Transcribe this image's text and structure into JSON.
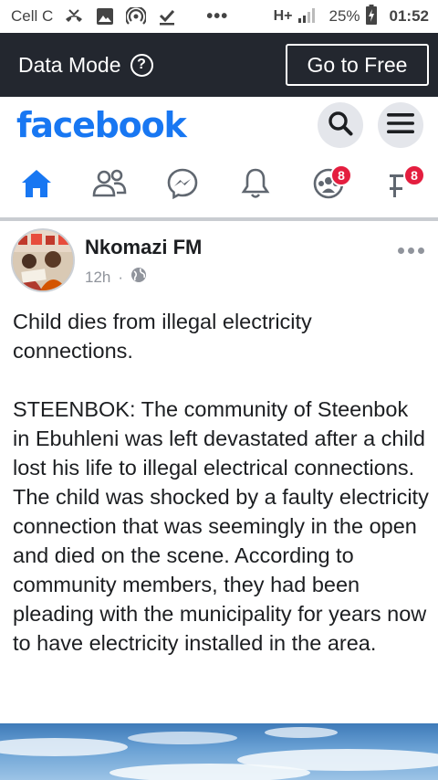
{
  "status_bar": {
    "carrier": "Cell C",
    "network": "H+",
    "battery": "25%",
    "time": "01:52"
  },
  "data_mode": {
    "label": "Data Mode",
    "go_free_label": "Go to Free"
  },
  "header": {
    "logo": "facebook"
  },
  "nav": {
    "tabs": [
      {
        "name": "home",
        "active": true
      },
      {
        "name": "friends"
      },
      {
        "name": "messenger"
      },
      {
        "name": "notifications"
      },
      {
        "name": "groups",
        "badge": "8"
      },
      {
        "name": "pages",
        "badge": "8"
      }
    ]
  },
  "post": {
    "page_name": "Nkomazi FM",
    "time": "12h",
    "dot": "·",
    "paragraphs": [
      "Child dies from illegal electricity connections.",
      "STEENBOK: The community of Steenbok in Ebuhleni was left devastated after a child lost his life to illegal electrical connections. The child was shocked by a faulty electricity connection that was seemingly in the open and died on the scene. According to community members, they had been pleading with the municipality for years now to have electricity installed in the area."
    ]
  },
  "colors": {
    "brand": "#1877f2",
    "badge": "#e41e3f",
    "data_bar": "#23272f"
  }
}
